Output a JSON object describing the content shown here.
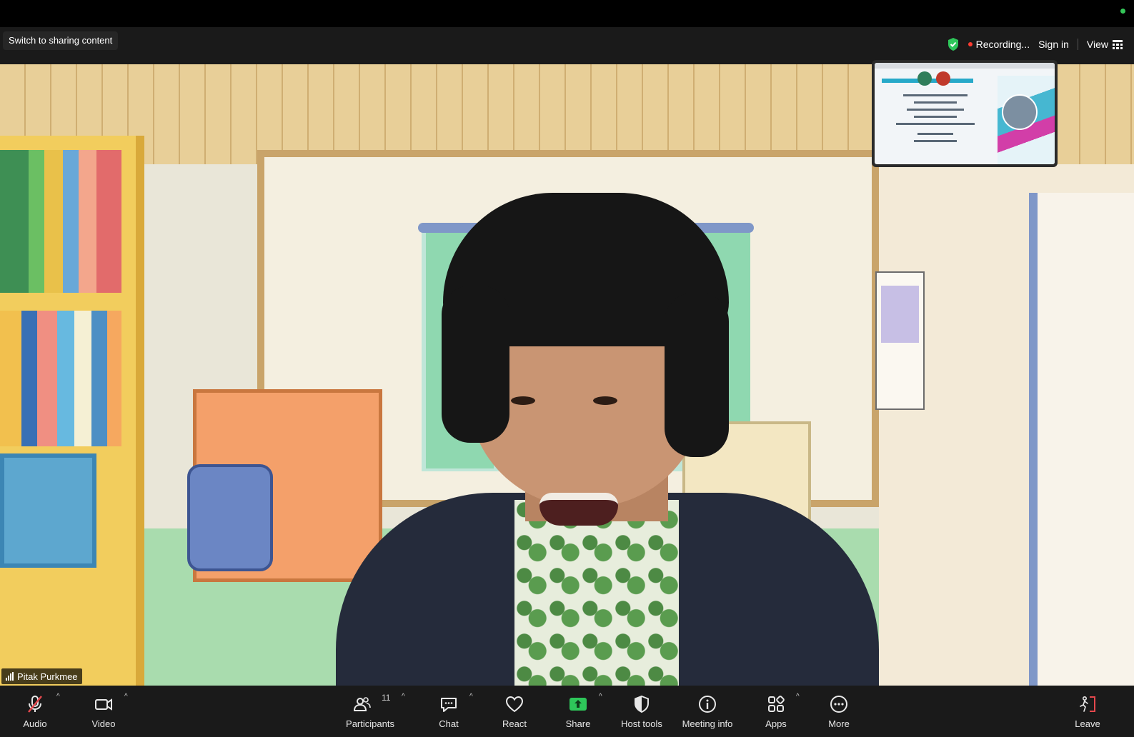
{
  "header": {
    "share_switch": "Switch to sharing content",
    "recording": "Recording...",
    "sign_in": "Sign in",
    "view": "View"
  },
  "participant": {
    "name": "Pitak Purkmee"
  },
  "toolbar": {
    "audio": "Audio",
    "video": "Video",
    "participants": "Participants",
    "participants_count": "11",
    "chat": "Chat",
    "react": "React",
    "share": "Share",
    "host_tools": "Host tools",
    "meeting_info": "Meeting info",
    "apps": "Apps",
    "more": "More",
    "leave": "Leave"
  },
  "colors": {
    "bar_bg": "#1a1a1a",
    "share_green": "#2ec75a",
    "recording_red": "#ff3b30",
    "leave_red": "#e5484d"
  },
  "icons": {
    "audio": "microphone-muted-icon",
    "video": "video-camera-icon",
    "participants": "participants-icon",
    "chat": "chat-icon",
    "react": "heart-icon",
    "share": "share-arrow-icon",
    "host_tools": "shield-icon",
    "meeting_info": "info-icon",
    "apps": "apps-icon",
    "more": "more-dots-icon",
    "leave": "leave-icon"
  }
}
